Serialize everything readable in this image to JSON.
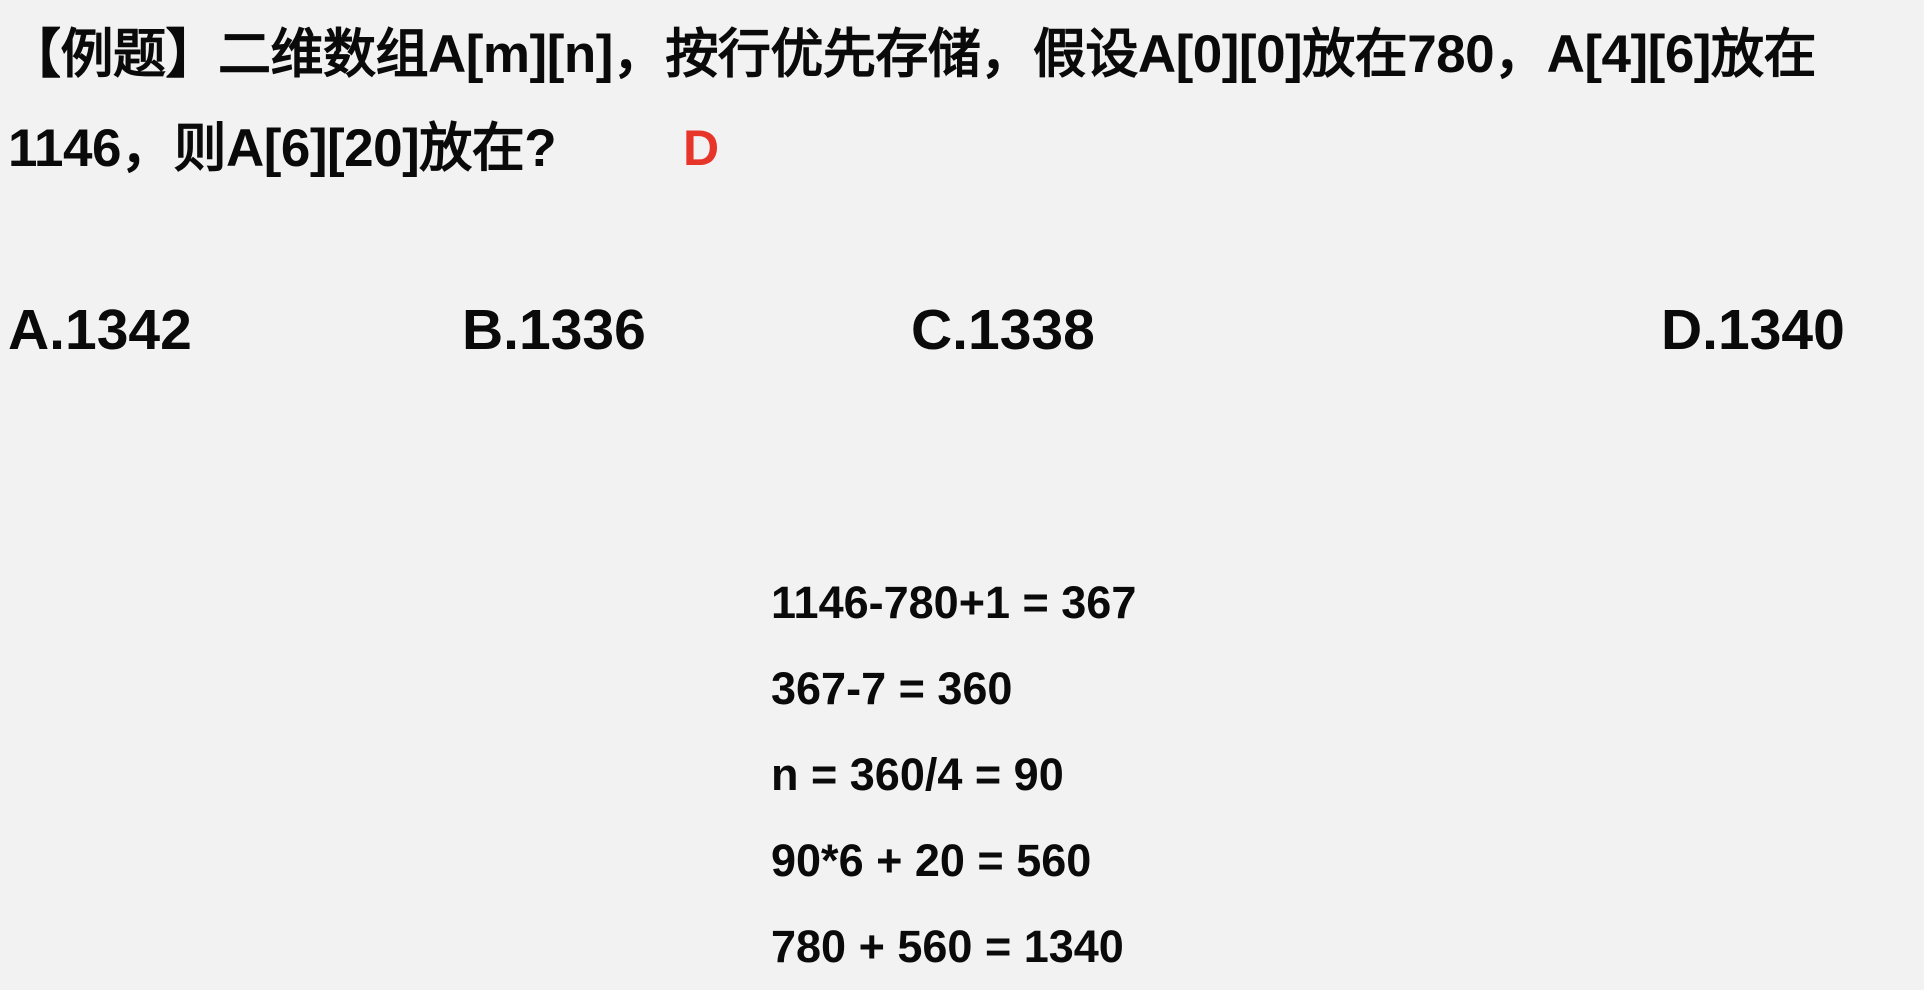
{
  "question": {
    "text": "【例题】二维数组A[m][n]，按行优先存储，假设A[0][0]放在780，A[4][6]放在1146，则A[6][20]放在?"
  },
  "answer": "D",
  "options": [
    {
      "label": "A.1342"
    },
    {
      "label": "B.1336"
    },
    {
      "label": "C.1338"
    },
    {
      "label": "D.1340"
    }
  ],
  "work": [
    "1146-780+1 = 367",
    "367-7 = 360",
    "n = 360/4 = 90",
    "90*6 + 20 = 560",
    "780 + 560 = 1340"
  ],
  "colors": {
    "background": "#f2f2f2",
    "text": "#0a0a0a",
    "answer": "#e8352a"
  }
}
